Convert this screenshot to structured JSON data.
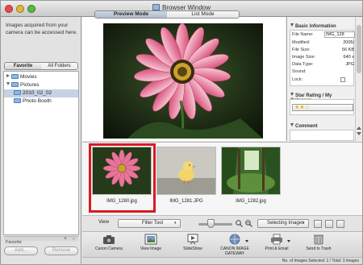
{
  "window": {
    "title": "Browser Window"
  },
  "left_panel": {
    "message": "Images acquired from your camera can be accessed here.",
    "tabs": [
      "Favorite Folders",
      "All Folders"
    ],
    "tree": [
      {
        "label": "Movies",
        "expanded": false,
        "selected": false
      },
      {
        "label": "Pictures",
        "expanded": true,
        "selected": false
      },
      {
        "label": "2010_02_02",
        "expanded": false,
        "selected": true
      },
      {
        "label": "Photo Booth",
        "expanded": false,
        "selected": false
      }
    ],
    "favorite_label": "Favorite",
    "add_label": "Add...",
    "remove_label": "Remove"
  },
  "mode_tabs": [
    "Preview Mode",
    "List Mode"
  ],
  "info_panel": {
    "basic_title": "Basic Information",
    "rows": [
      {
        "label": "File Name:",
        "value": "IMG_128"
      },
      {
        "label": "Modified:",
        "value": "2005/"
      },
      {
        "label": "File Size:",
        "value": "56 KB"
      },
      {
        "label": "Image Size:",
        "value": "640 x"
      },
      {
        "label": "Data Type:",
        "value": "JPG"
      },
      {
        "label": "Sound:",
        "value": ""
      },
      {
        "label": "Lock:",
        "value": ""
      }
    ],
    "star_title": "Star Rating / My Category",
    "star_value": "★★☆",
    "comment_title": "Comment"
  },
  "thumbnails": [
    {
      "label": "IMG_1280.jpg",
      "selected": true
    },
    {
      "label": "IMG_1281.JPG",
      "selected": false
    },
    {
      "label": "IMG_1282.jpg",
      "selected": false
    }
  ],
  "view_bar": {
    "view_label": "View",
    "filter_value": "Filter Tool",
    "slider_level": 0.35,
    "select_value": "Selecting Images"
  },
  "actions": [
    {
      "label": "Canon Camera",
      "icon": "camera-icon",
      "dropdown": false
    },
    {
      "label": "View Image",
      "icon": "view-image-icon",
      "dropdown": false
    },
    {
      "label": "SlideShow",
      "icon": "slideshow-icon",
      "dropdown": false
    },
    {
      "label": "CANON IMAGE GATEWAY",
      "icon": "canon-image-gateway-icon",
      "dropdown": true
    },
    {
      "label": "Print & Email",
      "icon": "print-icon",
      "dropdown": true
    },
    {
      "label": "Send to Trash",
      "icon": "trash-icon",
      "dropdown": false
    }
  ],
  "status": "No. of Images Selected: 1 / Total: 3 images",
  "colors": {
    "highlight": "#d81a25",
    "selection": "#c6d2e3",
    "accent": "#5a7fb5"
  }
}
